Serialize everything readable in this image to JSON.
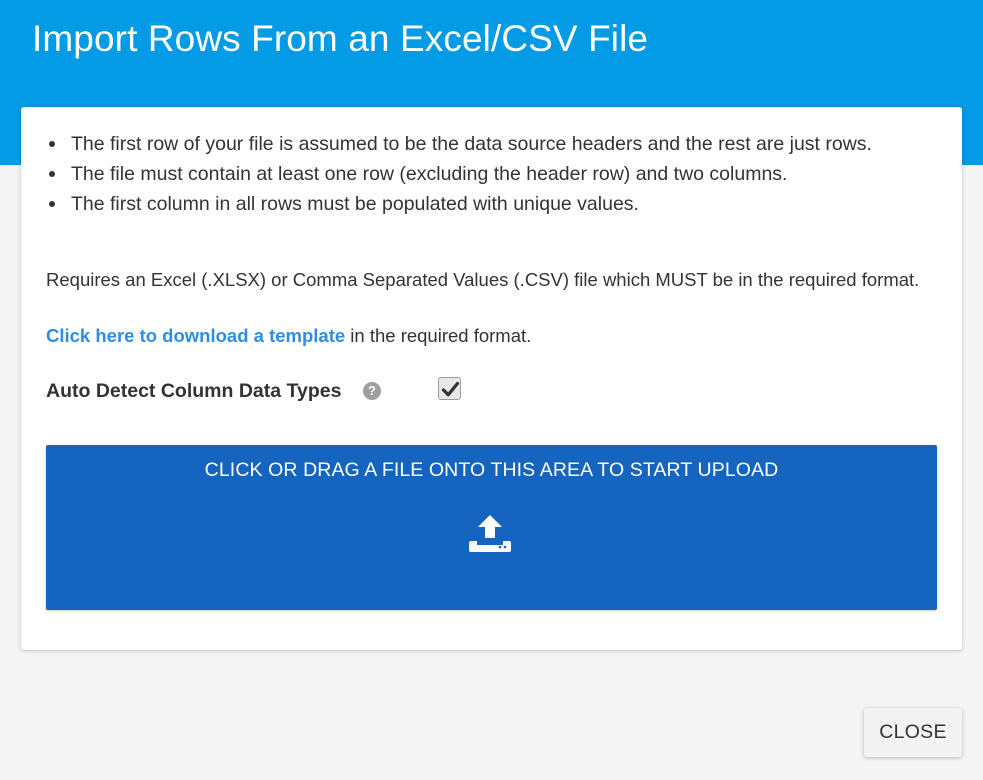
{
  "dialog": {
    "title": "Import Rows From an Excel/CSV File",
    "rules": [
      "The first row of your file is assumed to be the data source headers and the rest are just rows.",
      "The file must contain at least one row (excluding the header row) and two columns.",
      "The first column in all rows must be populated with unique values."
    ],
    "requires_text": "Requires an Excel (.XLSX) or Comma Separated Values (.CSV) file which MUST be in the required format.",
    "template_link_label": "Click here to download a template",
    "template_suffix": " in the required format.",
    "auto_detect_label": "Auto Detect Column Data Types",
    "auto_detect_checked": true,
    "help_icon_glyph": "?",
    "upload_prompt": "CLICK OR DRAG A FILE ONTO THIS AREA TO START UPLOAD",
    "close_label": "CLOSE"
  },
  "icons": {
    "help": "question-circle-icon",
    "checkbox_mark": "check-icon",
    "upload": "upload-tray-icon"
  },
  "colors": {
    "header": "#039be5",
    "upload_area": "#1565c0",
    "link": "#2e8ee6",
    "background": "#f5f5f5"
  }
}
